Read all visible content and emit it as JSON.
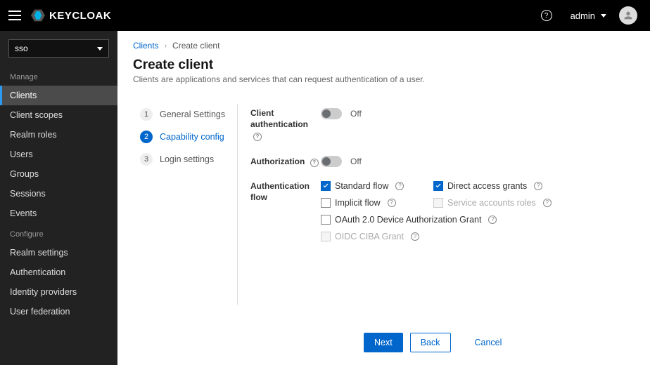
{
  "header": {
    "brand": "KEYCLOAK",
    "help_glyph": "?",
    "user_label": "admin"
  },
  "sidebar": {
    "realm_selected": "sso",
    "section_manage": "Manage",
    "section_configure": "Configure",
    "manage_items": [
      "Clients",
      "Client scopes",
      "Realm roles",
      "Users",
      "Groups",
      "Sessions",
      "Events"
    ],
    "configure_items": [
      "Realm settings",
      "Authentication",
      "Identity providers",
      "User federation"
    ],
    "active_item": "Clients"
  },
  "breadcrumb": {
    "root": "Clients",
    "current": "Create client"
  },
  "page": {
    "title": "Create client",
    "description": "Clients are applications and services that can request authentication of a user."
  },
  "wizard": {
    "steps": [
      {
        "num": "1",
        "label": "General Settings"
      },
      {
        "num": "2",
        "label": "Capability config"
      },
      {
        "num": "3",
        "label": "Login settings"
      }
    ],
    "active_index": 1
  },
  "form": {
    "client_auth_label": "Client authentication",
    "authorization_label": "Authorization",
    "auth_flow_label": "Authentication flow",
    "off_text": "Off",
    "flows": {
      "standard": {
        "label": "Standard flow",
        "checked": true,
        "disabled": false
      },
      "direct": {
        "label": "Direct access grants",
        "checked": true,
        "disabled": false
      },
      "implicit": {
        "label": "Implicit flow",
        "checked": false,
        "disabled": false
      },
      "service": {
        "label": "Service accounts roles",
        "checked": false,
        "disabled": true
      },
      "device": {
        "label": "OAuth 2.0 Device Authorization Grant",
        "checked": false,
        "disabled": false
      },
      "ciba": {
        "label": "OIDC CIBA Grant",
        "checked": false,
        "disabled": true
      }
    }
  },
  "footer": {
    "next": "Next",
    "back": "Back",
    "cancel": "Cancel"
  }
}
